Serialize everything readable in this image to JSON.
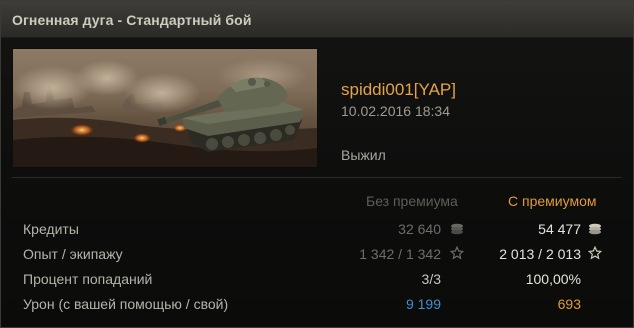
{
  "window": {
    "title": "Огненная дуга - Стандартный бой"
  },
  "player": {
    "name": "spiddi001[YAP]",
    "datetime": "10.02.2016 18:34",
    "status": "Выжил"
  },
  "stats": {
    "headers": {
      "without_premium": "Без премиума",
      "with_premium": "С премиумом"
    },
    "rows": [
      {
        "label": "Кредиты",
        "base": "32 640",
        "premium": "54 477",
        "icon": "credits-icon"
      },
      {
        "label": "Опыт / экипажу",
        "base": "1 342 / 1 342",
        "premium": "2 013 / 2 013",
        "icon": "experience-star-icon"
      },
      {
        "label": "Процент попаданий",
        "base": "3/3",
        "premium": "100,00%",
        "icon": ""
      },
      {
        "label": "Урон (с вашей помощью / свой)",
        "base": "9 199",
        "premium": "693",
        "icon": ""
      }
    ]
  },
  "colors": {
    "accent_orange": "#e09a3a",
    "damage_blue": "#3f8fd2",
    "title_text": "#cfcbbd"
  }
}
